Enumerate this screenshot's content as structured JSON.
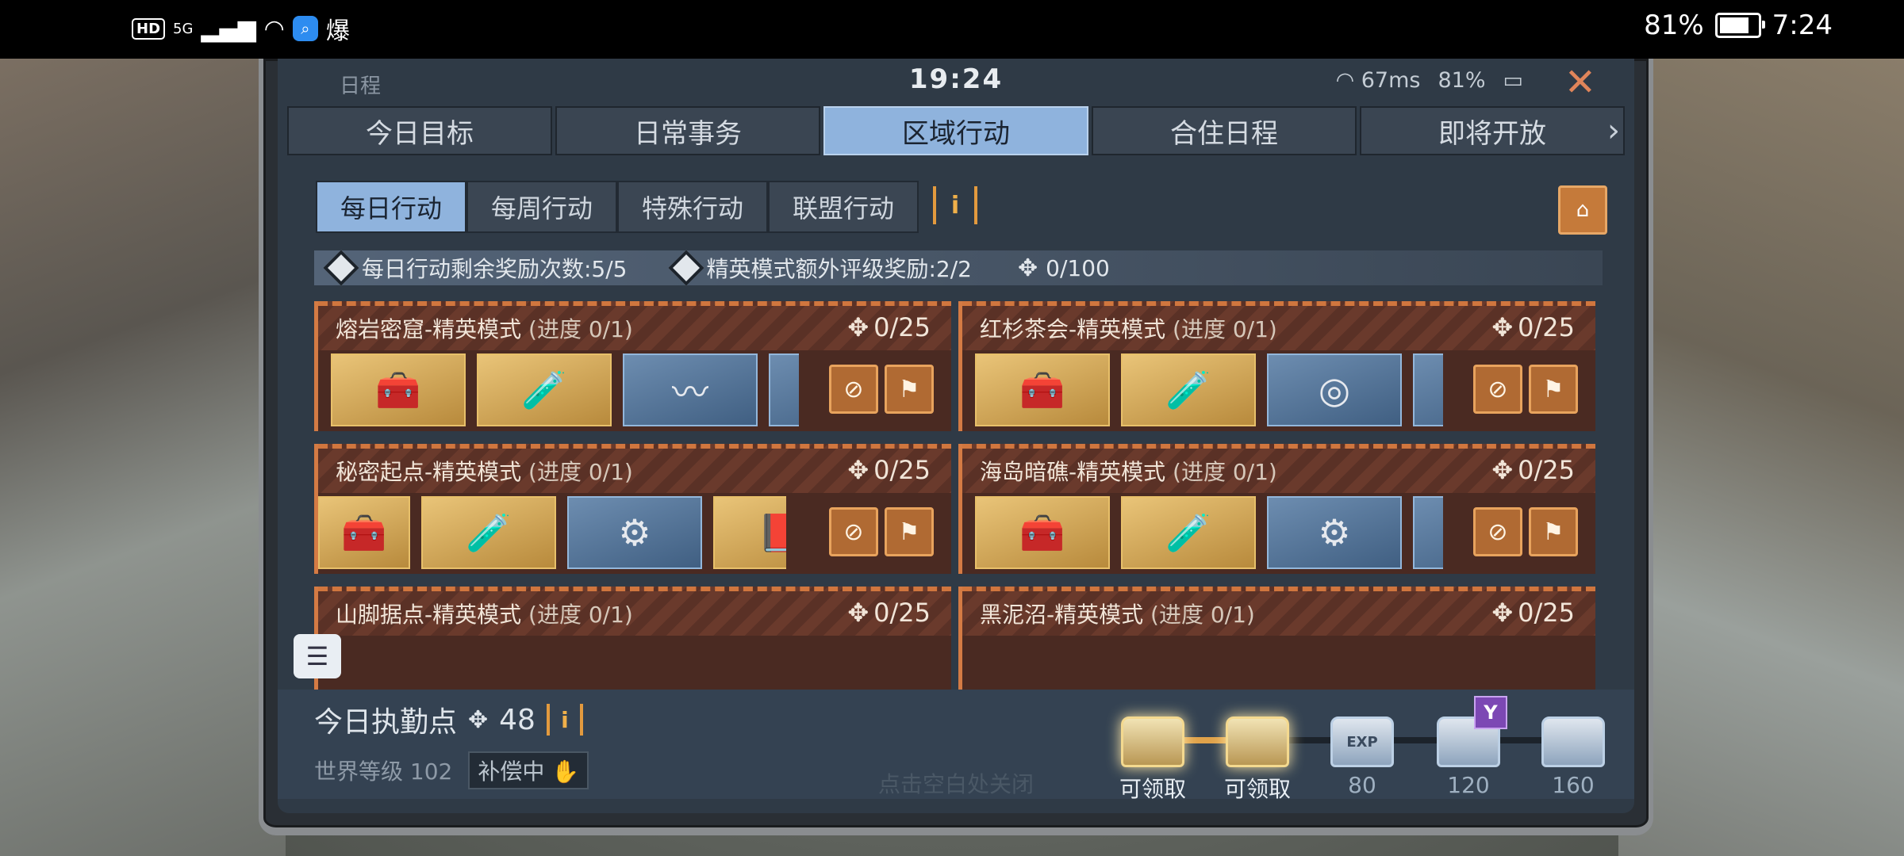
{
  "status_bar": {
    "left_badges": [
      "HD",
      "5G"
    ],
    "app_label": "爆",
    "battery_percent": "81%",
    "time": "7:24"
  },
  "header": {
    "title": "日程",
    "clock": "19:24",
    "ping": "67ms",
    "battery": "81%"
  },
  "tabs": [
    {
      "label": "今日目标",
      "active": false
    },
    {
      "label": "日常事务",
      "active": false
    },
    {
      "label": "区域行动",
      "active": true
    },
    {
      "label": "合住日程",
      "active": false
    },
    {
      "label": "即将开放",
      "active": false
    }
  ],
  "subtabs": [
    {
      "label": "每日行动",
      "active": true
    },
    {
      "label": "每周行动",
      "active": false
    },
    {
      "label": "特殊行动",
      "active": false
    },
    {
      "label": "联盟行动",
      "active": false
    }
  ],
  "info_label": "i",
  "reward_info": {
    "daily_remaining": "每日行动剩余奖励次数:5/5",
    "elite_bonus": "精英模式额外评级奖励:2/2",
    "duty_points": "0/100"
  },
  "cards": [
    {
      "title": "熔岩密窟-精英模式",
      "progress": "(进度 0/1)",
      "duty": "0/25"
    },
    {
      "title": "红杉茶会-精英模式",
      "progress": "(进度 0/1)",
      "duty": "0/25"
    },
    {
      "title": "秘密起点-精英模式",
      "progress": "(进度 0/1)",
      "duty": "0/25"
    },
    {
      "title": "海岛暗礁-精英模式",
      "progress": "(进度 0/1)",
      "duty": "0/25"
    },
    {
      "title": "山脚据点-精英模式",
      "progress": "(进度 0/1)",
      "duty": "0/25"
    },
    {
      "title": "黑泥沼-精英模式",
      "progress": "(进度 0/1)",
      "duty": "0/25"
    }
  ],
  "duty": {
    "title": "今日执勤点",
    "points": "48",
    "world_level": "世界等级 102",
    "compensation": "补偿中",
    "progress_fraction": 0.3
  },
  "chests": [
    {
      "label": "可领取",
      "ready": true,
      "tag": ""
    },
    {
      "label": "可领取",
      "ready": true,
      "tag": ""
    },
    {
      "label": "80",
      "ready": false,
      "tag": "EXP"
    },
    {
      "label": "120",
      "ready": false,
      "tag": "",
      "badge": "Y"
    },
    {
      "label": "160",
      "ready": false,
      "tag": ""
    }
  ],
  "close_hint": "点击空白处关闭"
}
